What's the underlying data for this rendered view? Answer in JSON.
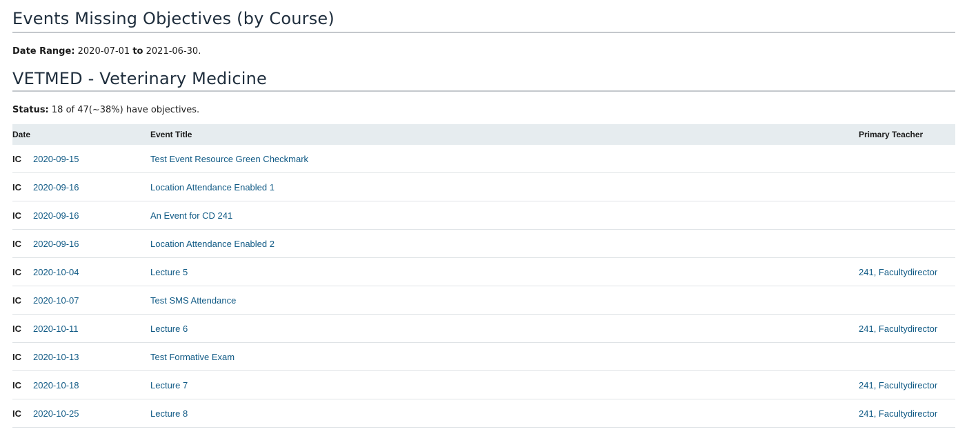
{
  "report": {
    "title": "Events Missing Objectives (by Course)",
    "date_range_label": "Date Range:",
    "date_from": "2020-07-01",
    "to_label": "to",
    "date_to": "2021-06-30",
    "period": "."
  },
  "course": {
    "title": "VETMED - Veterinary Medicine",
    "status_label": "Status:",
    "status_text": "18 of 47(~38%) have objectives."
  },
  "table": {
    "headers": {
      "date": "Date",
      "event_title": "Event Title",
      "primary_teacher": "Primary Teacher"
    },
    "rows": [
      {
        "type": "IC",
        "date": "2020-09-15",
        "title": "Test Event Resource Green Checkmark",
        "teacher": ""
      },
      {
        "type": "IC",
        "date": "2020-09-16",
        "title": "Location Attendance Enabled 1",
        "teacher": ""
      },
      {
        "type": "IC",
        "date": "2020-09-16",
        "title": "An Event for CD 241",
        "teacher": ""
      },
      {
        "type": "IC",
        "date": "2020-09-16",
        "title": "Location Attendance Enabled 2",
        "teacher": ""
      },
      {
        "type": "IC",
        "date": "2020-10-04",
        "title": "Lecture 5",
        "teacher": "241, Facultydirector"
      },
      {
        "type": "IC",
        "date": "2020-10-07",
        "title": "Test SMS Attendance",
        "teacher": ""
      },
      {
        "type": "IC",
        "date": "2020-10-11",
        "title": "Lecture 6",
        "teacher": "241, Facultydirector"
      },
      {
        "type": "IC",
        "date": "2020-10-13",
        "title": "Test Formative Exam",
        "teacher": ""
      },
      {
        "type": "IC",
        "date": "2020-10-18",
        "title": "Lecture 7",
        "teacher": "241, Facultydirector"
      },
      {
        "type": "IC",
        "date": "2020-10-25",
        "title": "Lecture 8",
        "teacher": "241, Facultydirector"
      }
    ]
  },
  "colors": {
    "link": "#105a85",
    "header_bg": "#e6ecef",
    "heading": "#1f2e3d"
  }
}
